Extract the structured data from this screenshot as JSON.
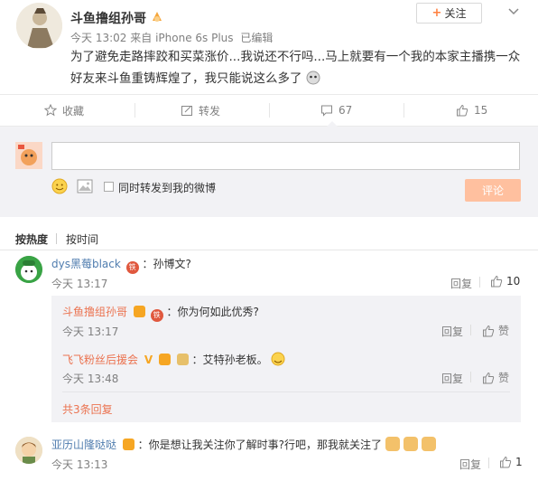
{
  "post": {
    "author": "斗鱼撸组孙哥",
    "follow_label": "关注",
    "meta_time": "今天 13:02",
    "meta_from": "来自",
    "meta_device": "iPhone 6s Plus",
    "meta_edited": "已编辑",
    "text": "为了避免走路摔跤和买菜涨价...我说还不行吗...马上就要有一个我的本家主播携一众好友来斗鱼重铸辉煌了，我只能说这么多了"
  },
  "actions": {
    "favorite": "收藏",
    "repost": "转发",
    "comment_count": "67",
    "like_count": "15"
  },
  "composer": {
    "placeholder": "",
    "sync_label": "同时转发到我的微博",
    "submit_label": "评论"
  },
  "sort_tabs": {
    "by_hot": "按热度",
    "by_time": "按时间"
  },
  "comments": [
    {
      "user": "dys黑莓black",
      "text": "：孙博文?",
      "time": "今天 13:17",
      "reply_label": "回复",
      "like_count": "10",
      "replies": [
        {
          "user": "斗鱼撸组孙哥",
          "text": "：你为何如此优秀?",
          "time": "今天 13:17",
          "reply_label": "回复",
          "like_label": "赞"
        },
        {
          "user": "飞飞粉丝后援会",
          "vip_mark": "V",
          "text": "：艾特孙老板。",
          "time": "今天 13:48",
          "reply_label": "回复",
          "like_label": "赞"
        }
      ],
      "more_replies": "共3条回复"
    },
    {
      "user": "亚历山隆哒哒",
      "text": "：你是想让我关注你了解时事?行吧，那我就关注了",
      "time": "今天 13:13",
      "reply_label": "回复",
      "like_count": "1"
    }
  ],
  "colors": {
    "accent": "#eb7350",
    "link_blue": "#507daf",
    "submit_bg": "#ffc09f",
    "panel_bg": "#f2f2f5"
  }
}
